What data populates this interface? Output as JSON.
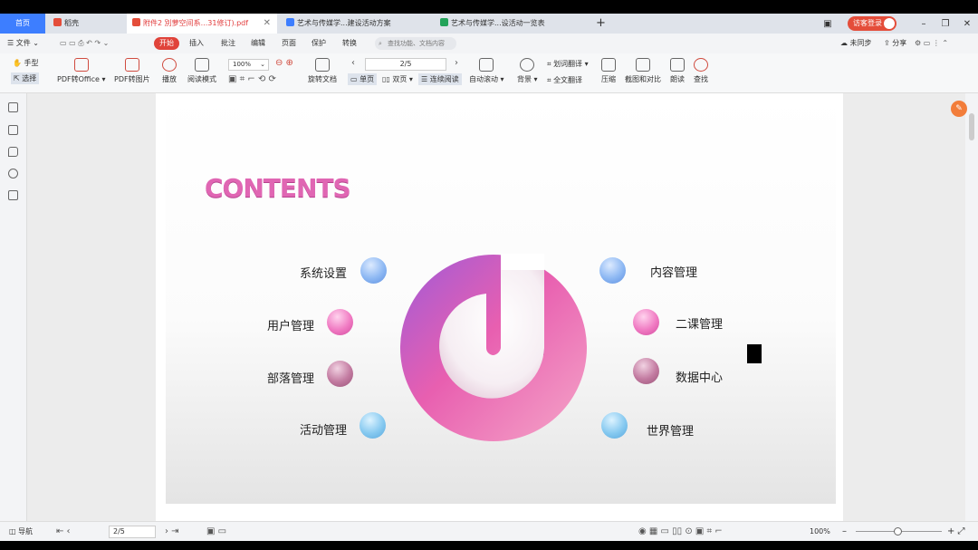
{
  "tabs": {
    "home": "首页",
    "t1": "稻壳",
    "t2": "附件2 別萝空间系...31修订).pdf",
    "t3": "艺术与传媒学...建设活动方案",
    "t4": "艺术与传媒学...设活动一览表",
    "new_tab": "+",
    "login": "访客登录"
  },
  "menu": {
    "file": "文件",
    "start": "开始",
    "insert": "插入",
    "annotate": "批注",
    "edit": "编辑",
    "page": "页面",
    "protect": "保护",
    "convert": "转换",
    "search_placeholder": "查找功能、文档内容",
    "unsynced": "未同步",
    "share": "分享"
  },
  "toolbar": {
    "hand": "手型",
    "select": "选择",
    "pdf_to_office": "PDF转Office",
    "pdf_to_image": "PDF转图片",
    "play": "播放",
    "read_mode": "阅读模式",
    "zoom": "100%",
    "rotate": "旋转文档",
    "single": "单页",
    "double": "双页",
    "continuous": "连续阅读",
    "auto_scroll": "自动滚动",
    "page_field": "2/5",
    "background": "背景",
    "translate": "划词翻译",
    "full_translate": "全文翻译",
    "compress": "压缩",
    "screenshot": "截图和对比",
    "read_aloud": "朗读",
    "find": "查找"
  },
  "slide": {
    "title": "CONTENTS",
    "left_items": [
      "系统设置",
      "用户管理",
      "部落管理",
      "活动管理"
    ],
    "right_items": [
      "内容管理",
      "二课管理",
      "数据中心",
      "世界管理"
    ]
  },
  "statusbar": {
    "nav": "导航",
    "page_field": "2/5",
    "zoom": "100%"
  },
  "colors": {
    "accent": "#e0433a",
    "title_pink": "#e066b3",
    "home_tab": "#3d7eff"
  }
}
